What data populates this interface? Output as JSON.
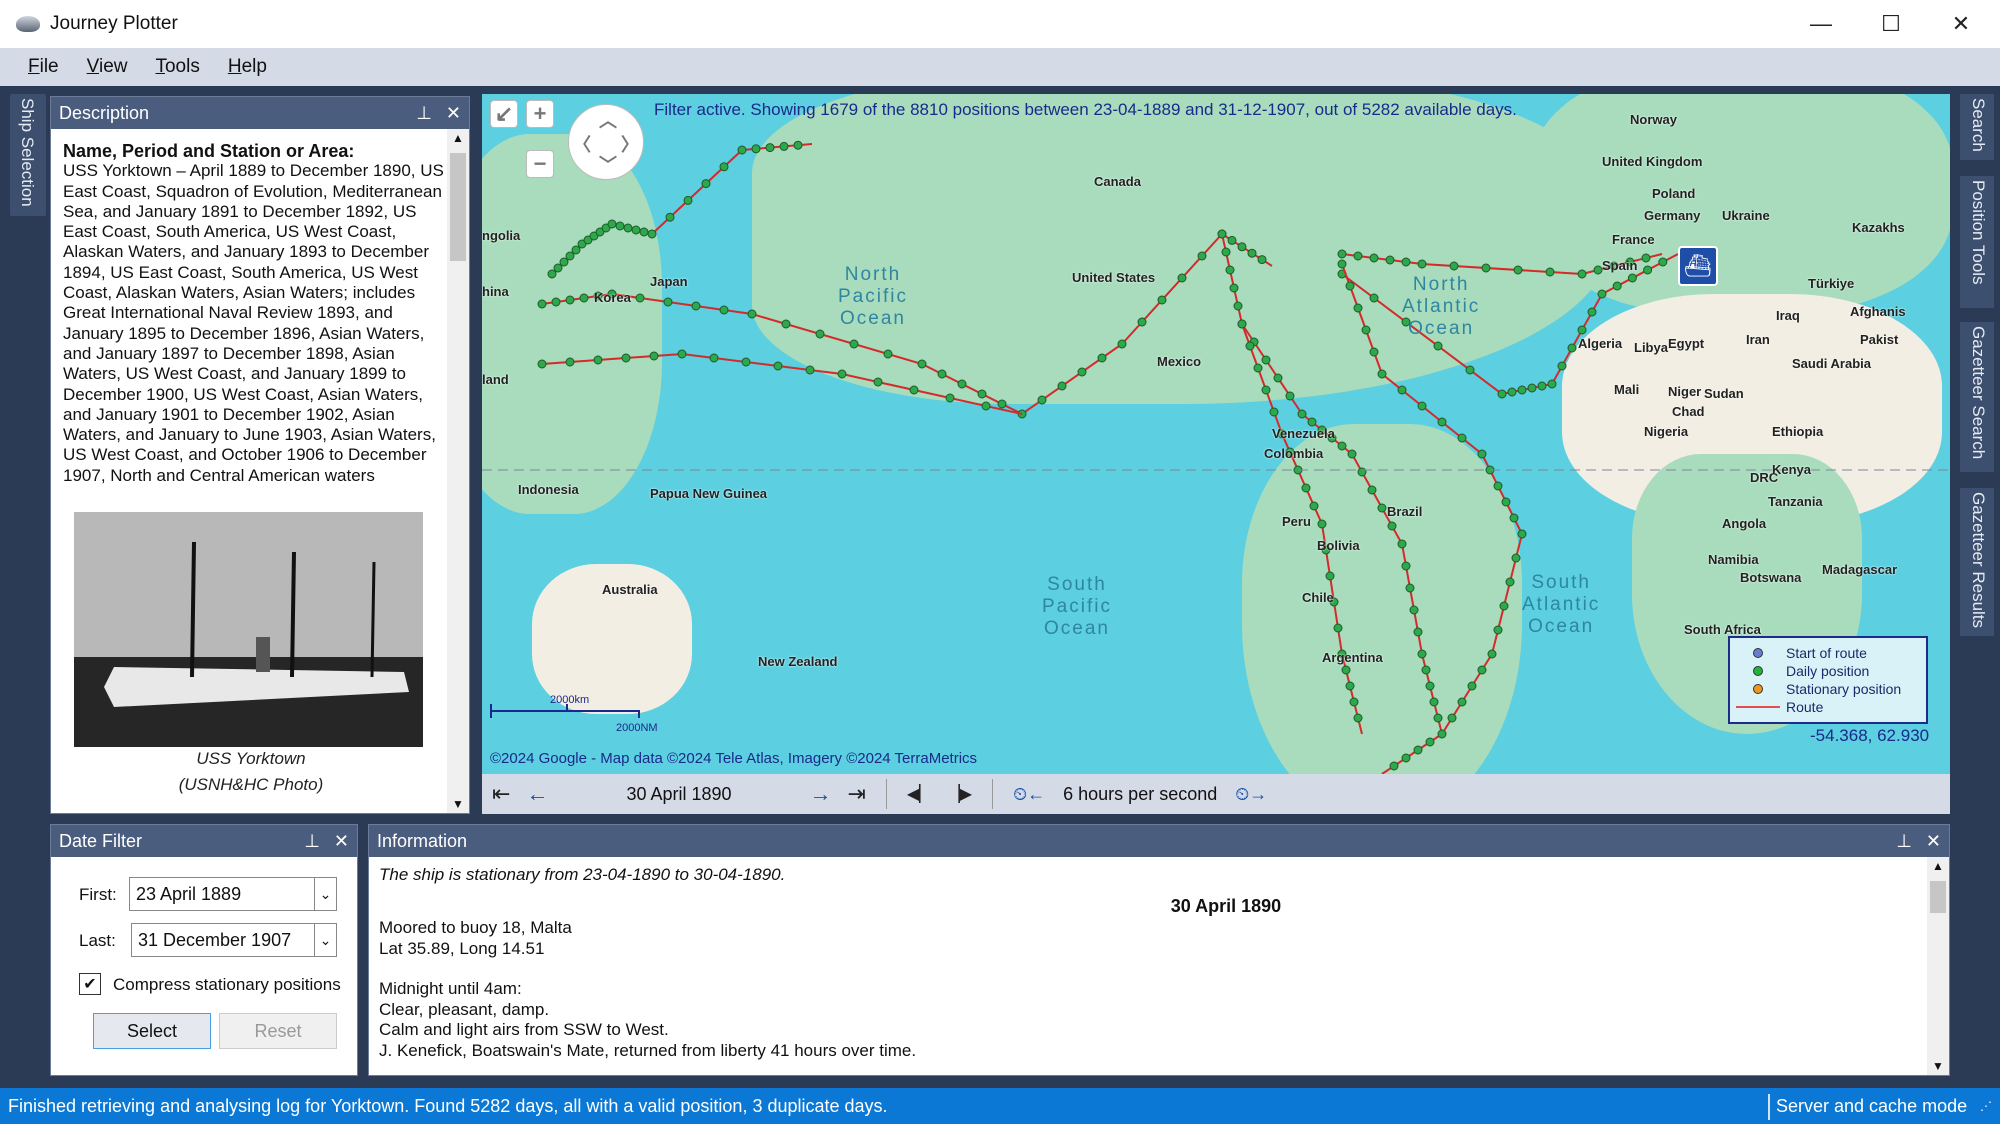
{
  "window": {
    "title": "Journey Plotter",
    "controls": {
      "minimize": "—",
      "maximize": "☐",
      "close": "✕"
    }
  },
  "menu": [
    {
      "label": "File",
      "accel": "F",
      "rest": "ile"
    },
    {
      "label": "View",
      "accel": "V",
      "rest": "iew"
    },
    {
      "label": "Tools",
      "accel": "T",
      "rest": "ools"
    },
    {
      "label": "Help",
      "accel": "H",
      "rest": "elp"
    }
  ],
  "left_tabs": [
    "Ship Selection"
  ],
  "right_tabs": [
    "Search",
    "Position Tools",
    "Gazetteer Search",
    "Gazetteer Results"
  ],
  "description": {
    "header": "Description",
    "heading": "Name, Period and Station or Area:",
    "body": "USS Yorktown – April 1889 to December 1890, US East Coast, Squadron of Evolution, Mediterranean Sea, and January 1891 to December 1892, US East Coast, South America, US West Coast, Alaskan Waters, and January 1893 to December 1894, US East Coast, South America, US West Coast, Alaskan Waters, Asian Waters; includes Great International Naval Review 1893, and January 1895 to December 1896, Asian Waters, and January 1897 to December 1898, Asian Waters, US West Coast, and January 1899 to December 1900, US West Coast, Asian Waters, and January 1901 to December 1902, Asian Waters, and January to June 1903, Asian Waters, US West Coast, and October 1906 to December 1907, North and Central American waters",
    "photo_caption_1": "USS Yorktown",
    "photo_caption_2": "(USNH&HC Photo)"
  },
  "map": {
    "filter_message": "Filter active. Showing 1679 of the 8810 positions between 23-04-1889 and 31-12-1907, out of 5282 available days.",
    "oceans": [
      {
        "name": "North\nPacific\nOcean",
        "id": "north-pacific"
      },
      {
        "name": "South\nPacific\nOcean",
        "id": "south-pacific"
      },
      {
        "name": "North\nAtlantic\nOcean",
        "id": "north-atlantic"
      },
      {
        "name": "South\nAtlantic\nOcean",
        "id": "south-atlantic"
      }
    ],
    "countries": [
      "Norway",
      "United Kingdom",
      "Poland",
      "Canada",
      "Germany",
      "Ukraine",
      "Kazakhs",
      "France",
      "Spain",
      "Türkiye",
      "United States",
      "Japan",
      "Korea",
      "hina",
      "ngolia",
      "Iraq",
      "Afghanis",
      "Iran",
      "Algeria",
      "Libya",
      "Egypt",
      "Pakist",
      "Saudi Arabia",
      "Mexico",
      "Mali",
      "Niger",
      "Sudan",
      "Chad",
      "Nigeria",
      "Ethiopia",
      "Venezuela",
      "Colombia",
      "land",
      "Indonesia",
      "Papua New Guinea",
      "DRC",
      "Kenya",
      "Tanzania",
      "Brazil",
      "Peru",
      "Bolivia",
      "Angola",
      "Namibia",
      "Botswana",
      "Madagascar",
      "Australia",
      "Chile",
      "South Africa",
      "New Zealand",
      "Argentina"
    ],
    "legend": [
      {
        "label": "Start of route",
        "color": "#6a7bd6",
        "type": "dot"
      },
      {
        "label": "Daily position",
        "color": "#22b43a",
        "type": "dot"
      },
      {
        "label": "Stationary position",
        "color": "#f0961e",
        "type": "dot"
      },
      {
        "label": "Route",
        "color": "#e05050",
        "type": "line"
      }
    ],
    "cursor_coords": "-54.368, 62.930",
    "scale_km": "2000km",
    "scale_nm": "2000NM",
    "attribution": "©2024 Google - Map data ©2024 Tele Atlas, Imagery ©2024 TerraMetrics",
    "route_color": "#d42a2a",
    "point_color": "#2da84a"
  },
  "player": {
    "current_date": "30 April 1890",
    "speed": "6 hours per second"
  },
  "date_filter": {
    "header": "Date Filter",
    "first_label": "First:",
    "first_value": "23 April 1889",
    "last_label": "Last:",
    "last_value": "31 December 1907",
    "compress_label": "Compress stationary positions",
    "compress_checked": true,
    "select_label": "Select",
    "reset_label": "Reset"
  },
  "information": {
    "header": "Information",
    "stationary_note": "The ship is stationary from 23-04-1890 to 30-04-1890.",
    "date_heading": "30 April 1890",
    "location": "Moored to buoy 18, Malta",
    "latlong": "Lat 35.89, Long 14.51",
    "watch": "Midnight until 4am:",
    "lines": [
      "Clear, pleasant, damp.",
      "Calm and light airs from SSW to West.",
      "J. Kenefick, Boatswain's Mate, returned from liberty 41 hours over time."
    ]
  },
  "status": {
    "message": "Finished retrieving and analysing log for Yorktown. Found 5282 days, all with a valid position, 3 duplicate days.",
    "mode": "Server and cache mode"
  }
}
